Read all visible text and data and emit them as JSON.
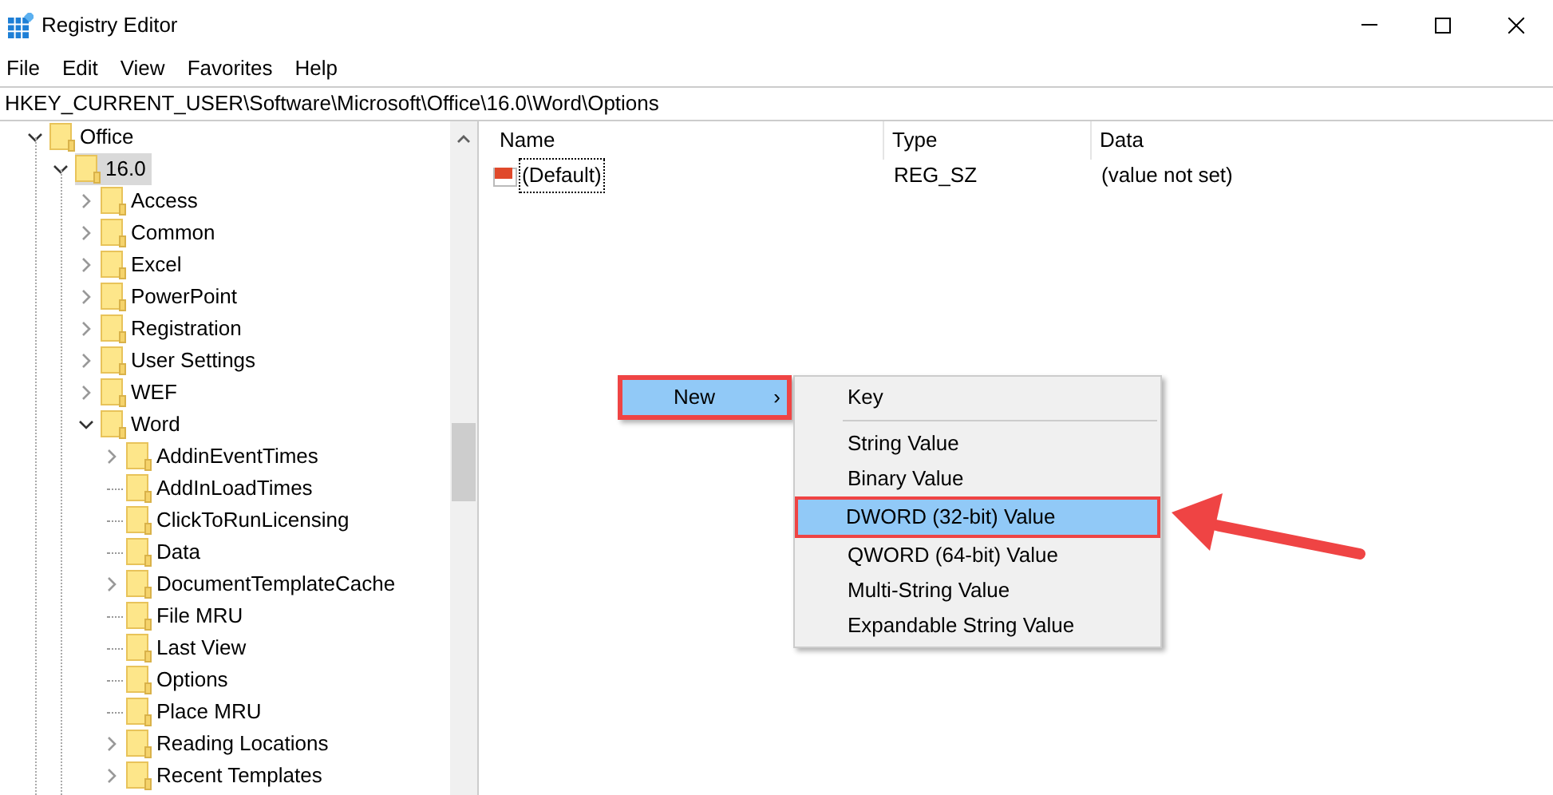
{
  "window": {
    "title": "Registry Editor"
  },
  "menu_bar": [
    "File",
    "Edit",
    "View",
    "Favorites",
    "Help"
  ],
  "address": "HKEY_CURRENT_USER\\Software\\Microsoft\\Office\\16.0\\Word\\Options",
  "tree": [
    {
      "name": "Office",
      "expandable": true,
      "expanded": true,
      "selected": false,
      "children": [
        {
          "name": "16.0",
          "expandable": true,
          "expanded": true,
          "selected": true,
          "children": [
            {
              "name": "Access",
              "expandable": true,
              "expanded": false,
              "selected": false
            },
            {
              "name": "Common",
              "expandable": true,
              "expanded": false,
              "selected": false
            },
            {
              "name": "Excel",
              "expandable": true,
              "expanded": false,
              "selected": false
            },
            {
              "name": "PowerPoint",
              "expandable": true,
              "expanded": false,
              "selected": false
            },
            {
              "name": "Registration",
              "expandable": true,
              "expanded": false,
              "selected": false
            },
            {
              "name": "User Settings",
              "expandable": true,
              "expanded": false,
              "selected": false
            },
            {
              "name": "WEF",
              "expandable": true,
              "expanded": false,
              "selected": false
            },
            {
              "name": "Word",
              "expandable": true,
              "expanded": true,
              "selected": false,
              "children": [
                {
                  "name": "AddinEventTimes",
                  "expandable": true,
                  "expanded": false,
                  "selected": false
                },
                {
                  "name": "AddInLoadTimes",
                  "expandable": false,
                  "expanded": false,
                  "selected": false
                },
                {
                  "name": "ClickToRunLicensing",
                  "expandable": false,
                  "expanded": false,
                  "selected": false
                },
                {
                  "name": "Data",
                  "expandable": false,
                  "expanded": false,
                  "selected": false
                },
                {
                  "name": "DocumentTemplateCache",
                  "expandable": true,
                  "expanded": false,
                  "selected": false
                },
                {
                  "name": "File MRU",
                  "expandable": false,
                  "expanded": false,
                  "selected": false
                },
                {
                  "name": "Last View",
                  "expandable": false,
                  "expanded": false,
                  "selected": false
                },
                {
                  "name": "Options",
                  "expandable": false,
                  "expanded": false,
                  "selected": false
                },
                {
                  "name": "Place MRU",
                  "expandable": false,
                  "expanded": false,
                  "selected": false
                },
                {
                  "name": "Reading Locations",
                  "expandable": true,
                  "expanded": false,
                  "selected": false
                },
                {
                  "name": "Recent Templates",
                  "expandable": true,
                  "expanded": false,
                  "selected": false
                }
              ]
            }
          ]
        }
      ]
    }
  ],
  "values_table": {
    "columns": [
      "Name",
      "Type",
      "Data"
    ],
    "rows": [
      {
        "name": "(Default)",
        "type": "REG_SZ",
        "data": "(value not set)",
        "focused": true
      }
    ]
  },
  "context_menu": {
    "item": {
      "label": "New",
      "arrow": "›",
      "highlighted": true
    }
  },
  "submenu": [
    {
      "kind": "item",
      "label": "Key",
      "highlighted": false
    },
    {
      "kind": "separator"
    },
    {
      "kind": "item",
      "label": "String Value",
      "highlighted": false
    },
    {
      "kind": "item",
      "label": "Binary Value",
      "highlighted": false
    },
    {
      "kind": "item",
      "label": "DWORD (32-bit) Value",
      "highlighted": true
    },
    {
      "kind": "item",
      "label": "QWORD (64-bit) Value",
      "highlighted": false
    },
    {
      "kind": "item",
      "label": "Multi-String Value",
      "highlighted": false
    },
    {
      "kind": "item",
      "label": "Expandable String Value",
      "highlighted": false
    }
  ]
}
